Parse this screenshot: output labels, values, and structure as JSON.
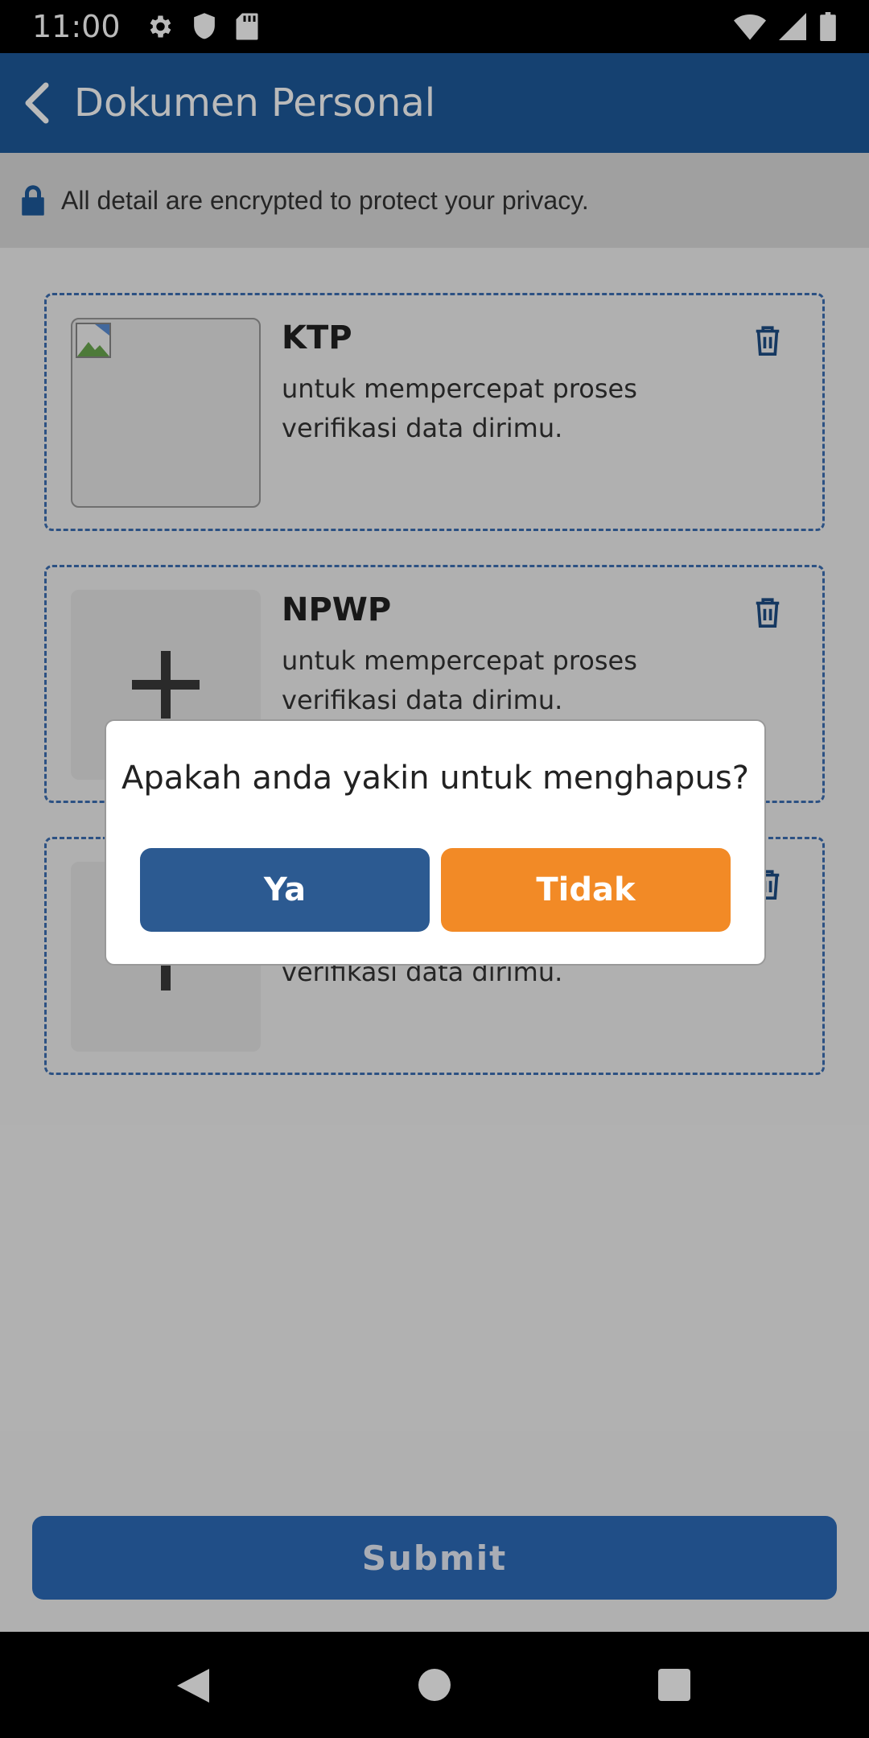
{
  "status_bar": {
    "time": "11:00",
    "left_icons": [
      "settings-icon",
      "shield-icon",
      "sd-card-icon"
    ],
    "right_icons": [
      "wifi-icon",
      "signal-icon",
      "battery-icon"
    ]
  },
  "app_bar": {
    "back_icon": "chevron-left-icon",
    "title": "Dokumen Personal"
  },
  "privacy_banner": {
    "icon": "lock-icon",
    "text": "All detail are encrypted to protect your privacy."
  },
  "documents": [
    {
      "title": "KTP",
      "description": "untuk mempercepat proses verifikasi data dirimu.",
      "thumbnail": "broken-image"
    },
    {
      "title": "NPWP",
      "description": "untuk mempercepat proses verifikasi data dirimu.",
      "thumbnail": "add"
    },
    {
      "title": "",
      "description": "untuk mempercepat proses verifikasi data dirimu.",
      "thumbnail": "add"
    }
  ],
  "submit_label": "Submit",
  "dialog": {
    "message": "Apakah anda yakin untuk menghapus?",
    "yes_label": "Ya",
    "no_label": "Tidak"
  },
  "colors": {
    "app_bar": "#1e5a9c",
    "card_border": "#3d6fb4",
    "submit": "#2d6cb9",
    "dialog_yes": "#2c5a91",
    "dialog_no": "#f28a26"
  },
  "nav_bar": {
    "icons": [
      "nav-back-icon",
      "nav-home-icon",
      "nav-recents-icon"
    ]
  }
}
